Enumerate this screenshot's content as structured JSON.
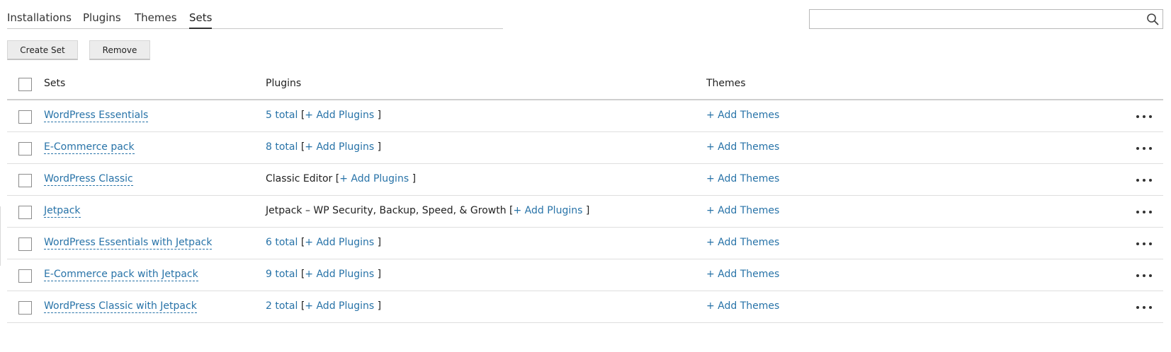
{
  "tabs": [
    {
      "label": "Installations"
    },
    {
      "label": "Plugins"
    },
    {
      "label": "Themes"
    },
    {
      "label": "Sets",
      "active": true
    }
  ],
  "search": {
    "value": "",
    "icon": "search-icon"
  },
  "toolbar": {
    "create_label": "Create Set",
    "remove_label": "Remove"
  },
  "table": {
    "headers": {
      "sets": "Sets",
      "plugins": "Plugins",
      "themes": "Themes"
    },
    "add_plugins": "+ Add Plugins",
    "add_themes": "+ Add Themes",
    "rows": [
      {
        "name": "WordPress Essentials",
        "plugins": "5 total",
        "plugins_is_link": true
      },
      {
        "name": "E-Commerce pack",
        "plugins": "8 total",
        "plugins_is_link": true
      },
      {
        "name": "WordPress Classic",
        "plugins": "Classic Editor",
        "plugins_is_link": false
      },
      {
        "name": "Jetpack",
        "plugins": "Jetpack – WP Security, Backup, Speed, & Growth",
        "plugins_is_link": false
      },
      {
        "name": "WordPress Essentials with Jetpack",
        "plugins": "6 total",
        "plugins_is_link": true
      },
      {
        "name": "E-Commerce pack with Jetpack",
        "plugins": "9 total",
        "plugins_is_link": true
      },
      {
        "name": "WordPress Classic with Jetpack",
        "plugins": "2 total",
        "plugins_is_link": true
      }
    ]
  },
  "colors": {
    "link": "#2873a8",
    "text": "#222222",
    "border": "#dedede"
  }
}
